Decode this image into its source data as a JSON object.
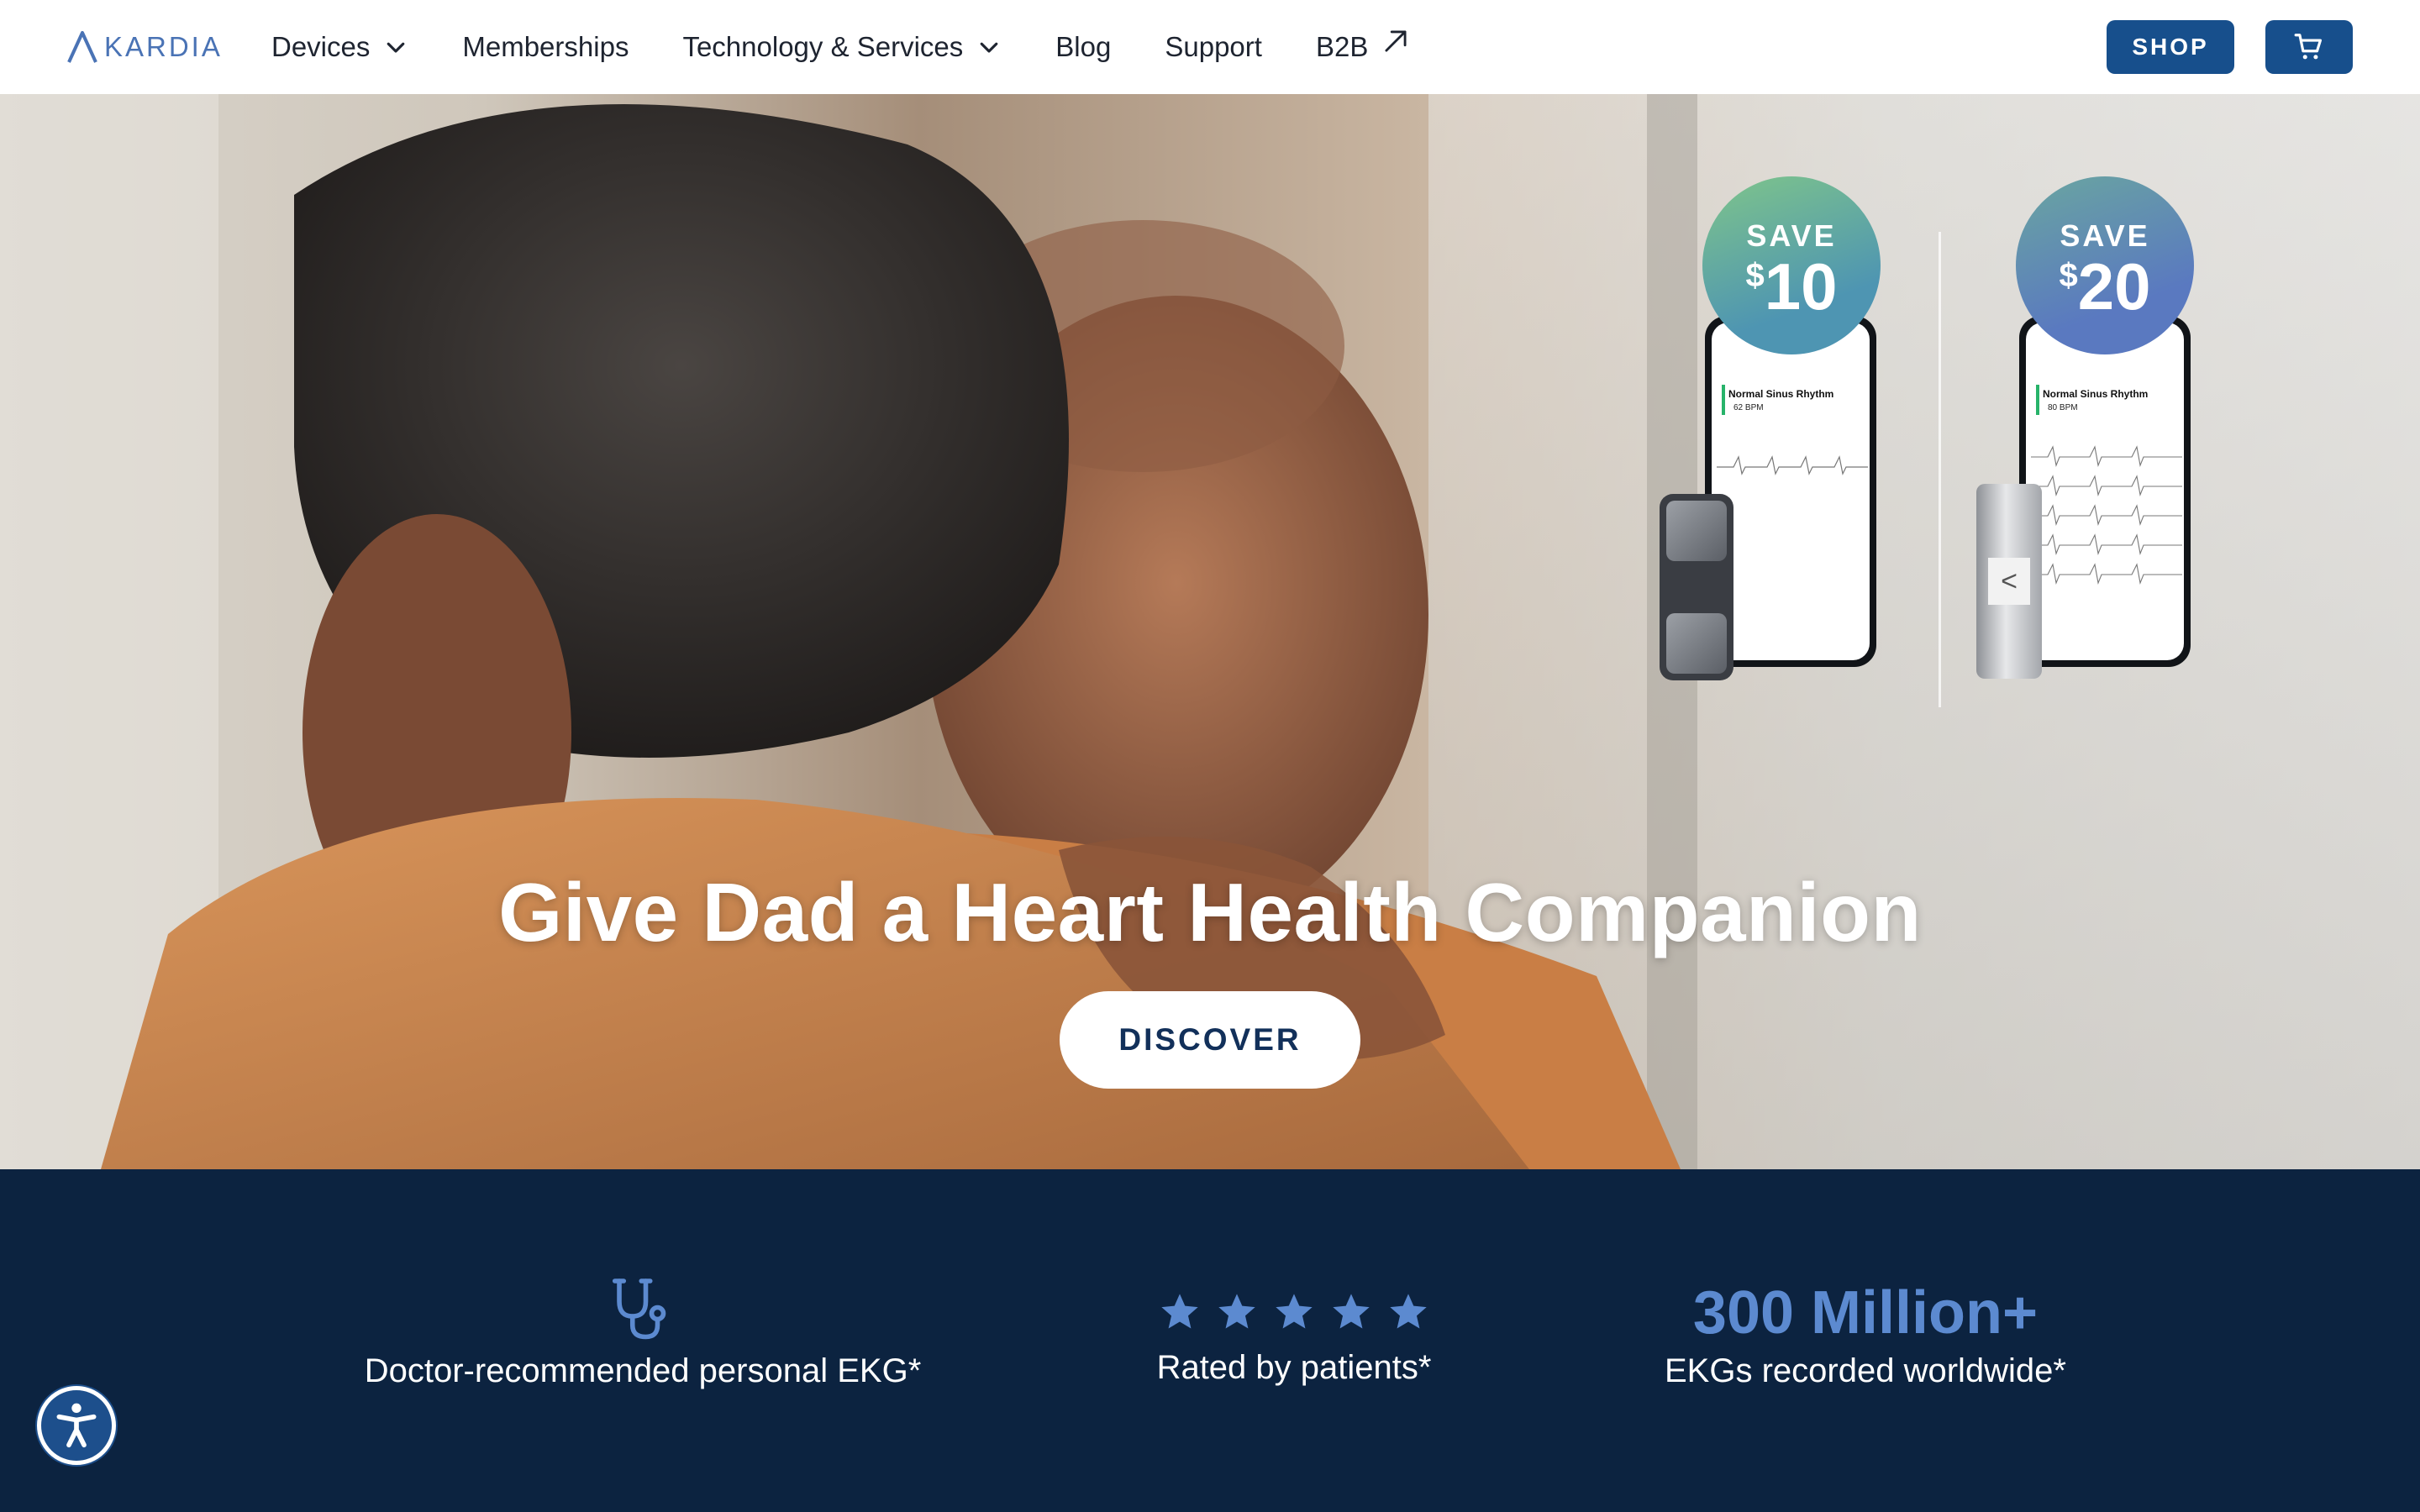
{
  "colors": {
    "brand_blue": "#174f8c",
    "navy_band": "#0c2340",
    "accent_blue": "#5c8ad0",
    "logo_blue": "#4a73b5"
  },
  "brand": {
    "logo_text": "KARDIA",
    "logo_icon": "kardia-chevron-logo"
  },
  "nav": {
    "items": [
      {
        "label": "Devices",
        "icon": "chevron-down-icon"
      },
      {
        "label": "Memberships"
      },
      {
        "label": "Technology & Services",
        "icon": "chevron-down-icon"
      },
      {
        "label": "Blog"
      },
      {
        "label": "Support"
      },
      {
        "label": "B2B",
        "icon": "external-arrow-icon"
      }
    ],
    "shop_label": "SHOP",
    "cart_icon": "cart-icon"
  },
  "hero": {
    "title": "Give Dad a Heart Health Companion",
    "cta_label": "DISCOVER",
    "promos": [
      {
        "save_word": "SAVE",
        "currency": "$",
        "amount": "10",
        "screen_status": "Normal Sinus Rhythm",
        "screen_bpm": "62 BPM"
      },
      {
        "save_word": "SAVE",
        "currency": "$",
        "amount": "20",
        "screen_status": "Normal Sinus Rhythm",
        "screen_bpm": "80 BPM"
      }
    ]
  },
  "stats": [
    {
      "icon": "stethoscope-icon",
      "label": "Doctor-recommended personal EKG*"
    },
    {
      "icon": "star-icon",
      "rating_stars": 5,
      "label": "Rated by patients*"
    },
    {
      "value": "300 Million+",
      "label": "EKGs recorded worldwide*"
    }
  ],
  "accessibility": {
    "icon": "accessibility-icon"
  }
}
